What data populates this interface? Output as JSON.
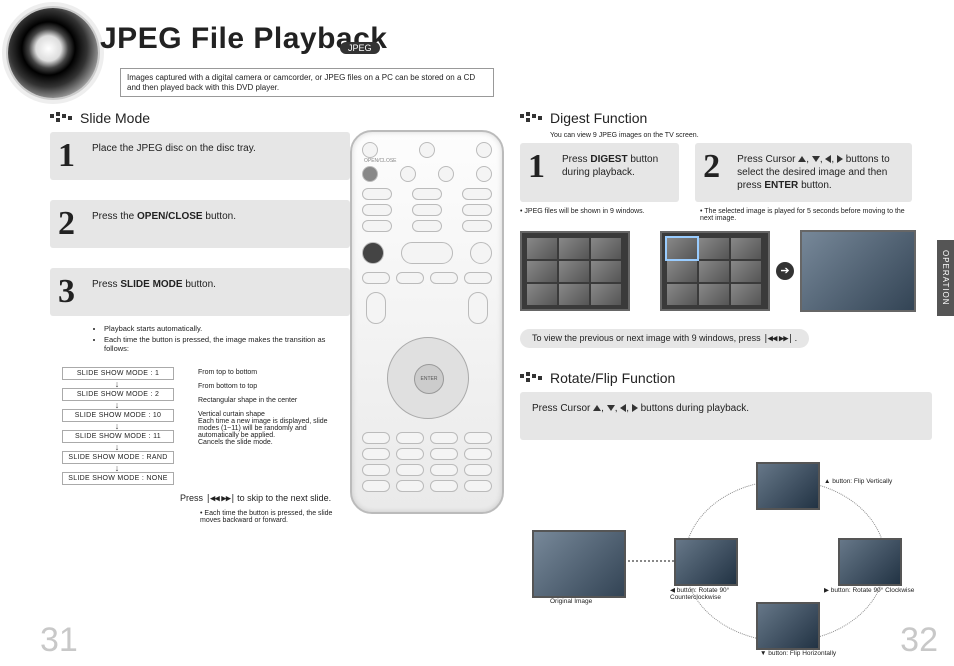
{
  "title": "JPEG File Playback",
  "badge": "JPEG",
  "intro": "Images captured with a digital camera or camcorder, or JPEG files on a PC can be stored on a CD and then played back with this DVD player.",
  "side_tab": "OPERATION",
  "page_left": "31",
  "page_right": "32",
  "slide": {
    "heading": "Slide Mode",
    "step1": "Place the JPEG disc on the disc tray.",
    "step2_pre": "Press the ",
    "step2_bold": "OPEN/CLOSE",
    "step2_post": " button.",
    "step3_pre": "Press ",
    "step3_bold": "SLIDE MODE",
    "step3_post": " button.",
    "notes": [
      "Playback starts automatically.",
      "Each time the button is pressed, the image makes the transition as follows:"
    ],
    "modes": [
      {
        "label": "SLIDE SHOW MODE : 1",
        "desc": "From top to bottom"
      },
      {
        "label": "SLIDE SHOW MODE : 2",
        "desc": "From bottom to top"
      },
      {
        "label": "SLIDE SHOW MODE : 10",
        "desc": "Rectangular shape in the center"
      },
      {
        "label": "SLIDE SHOW MODE : 11",
        "desc": "Vertical curtain shape"
      },
      {
        "label": "SLIDE SHOW MODE : RAND",
        "desc": "Each time a new image is displayed, slide modes (1~11) will be randomly and automatically be applied."
      },
      {
        "label": "SLIDE SHOW MODE : NONE",
        "desc": "Cancels the slide mode."
      }
    ],
    "skip_pre": "Press ",
    "skip_post": " to skip to the next slide.",
    "skip_note": "Each time the button is pressed, the slide moves backward or forward."
  },
  "digest": {
    "heading": "Digest Function",
    "sub": "You can view 9 JPEG images on the TV screen.",
    "step1_pre": "Press ",
    "step1_bold": "DIGEST",
    "step1_post": " button during playback.",
    "step1_note": "JPEG files will be shown in 9 windows.",
    "step2_pre": "Press Cursor ",
    "step2_mid": " buttons to select the desired image and then press ",
    "step2_bold": "ENTER",
    "step2_post": " button.",
    "step2_note": "The selected image is played for 5 seconds before moving to the next image.",
    "view_line_pre": "To view the previous or next image with 9 windows, press ",
    "view_line_post": "."
  },
  "rotate": {
    "heading": "Rotate/Flip Function",
    "instr_pre": "Press Cursor ",
    "instr_post": " buttons during playback.",
    "caps": {
      "orig": "Original Image",
      "up": "▲ button: Flip Vertically",
      "down": "▼ button: Flip Horizontally",
      "left": "◀ button: Rotate 90° Counterclockwise",
      "right": "▶ button: Rotate 90° Clockwise"
    }
  },
  "remote_labels": {
    "open_close": "OPEN/CLOSE",
    "enter": "ENTER"
  }
}
